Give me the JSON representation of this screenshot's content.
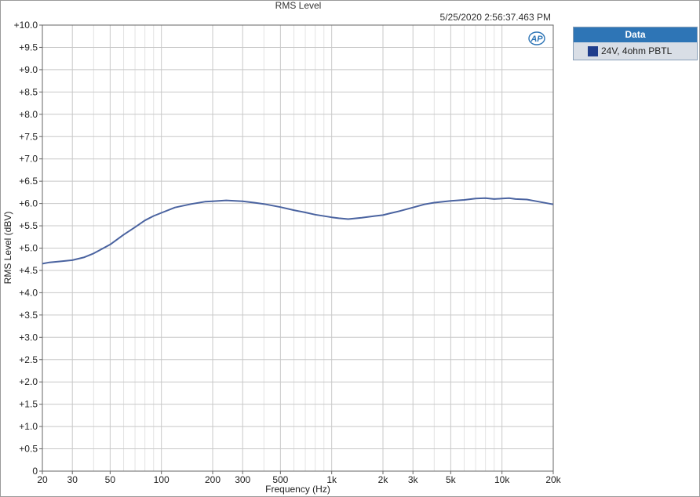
{
  "chart_data": {
    "type": "line",
    "title": "RMS Level",
    "timestamp": "5/25/2020 2:56:37.463 PM",
    "xlabel": "Frequency (Hz)",
    "ylabel": "RMS Level (dBV)",
    "x_scale": "log",
    "xlim": [
      20,
      20000
    ],
    "ylim": [
      0,
      10
    ],
    "grid": true,
    "legend_position": "outside-top-right",
    "legend_title": "Data",
    "x_ticks": [
      {
        "value": 20,
        "label": "20"
      },
      {
        "value": 30,
        "label": "30"
      },
      {
        "value": 50,
        "label": "50"
      },
      {
        "value": 100,
        "label": "100"
      },
      {
        "value": 200,
        "label": "200"
      },
      {
        "value": 300,
        "label": "300"
      },
      {
        "value": 500,
        "label": "500"
      },
      {
        "value": 1000,
        "label": "1k"
      },
      {
        "value": 2000,
        "label": "2k"
      },
      {
        "value": 3000,
        "label": "3k"
      },
      {
        "value": 5000,
        "label": "5k"
      },
      {
        "value": 10000,
        "label": "10k"
      },
      {
        "value": 20000,
        "label": "20k"
      }
    ],
    "y_ticks": [
      "0",
      "+0.5",
      "+1.0",
      "+1.5",
      "+2.0",
      "+2.5",
      "+3.0",
      "+3.5",
      "+4.0",
      "+4.5",
      "+5.0",
      "+5.5",
      "+6.0",
      "+6.5",
      "+7.0",
      "+7.5",
      "+8.0",
      "+8.5",
      "+9.0",
      "+9.5",
      "+10.0"
    ],
    "series": [
      {
        "name": "24V, 4ohm PBTL",
        "color": "#4a63a0",
        "x": [
          20,
          22,
          25,
          30,
          35,
          40,
          50,
          60,
          70,
          80,
          90,
          100,
          120,
          150,
          180,
          200,
          240,
          300,
          350,
          400,
          500,
          600,
          700,
          800,
          1000,
          1100,
          1250,
          1500,
          1800,
          2000,
          2200,
          2500,
          3000,
          3500,
          4000,
          5000,
          6000,
          7000,
          8000,
          9000,
          10000,
          11000,
          12000,
          14000,
          16000,
          20000
        ],
        "y": [
          4.65,
          4.68,
          4.7,
          4.73,
          4.79,
          4.88,
          5.08,
          5.3,
          5.47,
          5.62,
          5.72,
          5.79,
          5.91,
          5.99,
          6.04,
          6.05,
          6.07,
          6.05,
          6.02,
          5.99,
          5.92,
          5.85,
          5.8,
          5.75,
          5.69,
          5.67,
          5.65,
          5.68,
          5.72,
          5.74,
          5.78,
          5.83,
          5.91,
          5.98,
          6.02,
          6.06,
          6.08,
          6.11,
          6.12,
          6.1,
          6.11,
          6.12,
          6.1,
          6.09,
          6.05,
          5.98
        ]
      }
    ]
  }
}
